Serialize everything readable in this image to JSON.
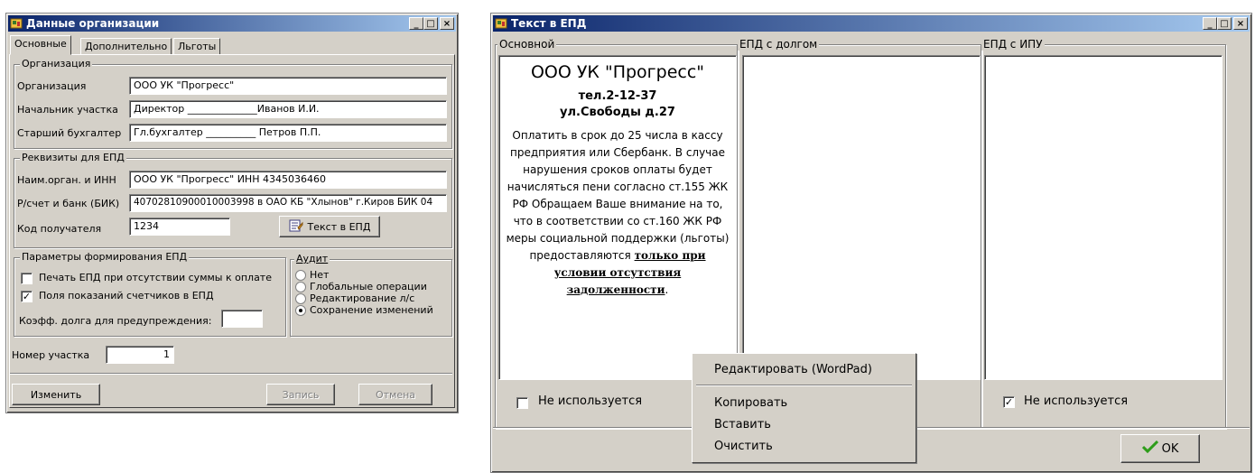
{
  "left_window": {
    "title": "Данные организации",
    "tabs": [
      "Основные",
      "Дополнительно",
      "Льготы"
    ],
    "org_group": {
      "title": "Организация",
      "rows": [
        {
          "label": "Организация",
          "value": "ООО УК \"Прогресс\""
        },
        {
          "label": "Начальник участка",
          "value": "Директор ______________Иванов И.И."
        },
        {
          "label": "Старший бухгалтер",
          "value": "Гл.бухгалтер __________ Петров П.П."
        }
      ]
    },
    "req_group": {
      "title": "Реквизиты для ЕПД",
      "rows": [
        {
          "label": "Наим.орган. и ИНН",
          "value": "ООО УК \"Прогресс\"  ИНН 4345036460"
        },
        {
          "label": "Р/счет и банк (БИК)",
          "value": "40702810900010003998 в ОАО КБ \"Хлынов\" г.Киров БИК 04"
        },
        {
          "label": "Код получателя",
          "value": "1234"
        }
      ],
      "epd_button": "Текст в ЕПД"
    },
    "params_group": {
      "title": "Параметры формирования ЕПД",
      "print_no_sum": {
        "label": "Печать ЕПД при отсутствии суммы к оплате",
        "checked": false
      },
      "meter_fields": {
        "label": "Поля показаний счетчиков в ЕПД",
        "checked": true
      },
      "coef_label": "Коэфф. долга для предупреждения:",
      "coef_value": ""
    },
    "audit_group": {
      "title": "Аудит",
      "options": [
        {
          "label": "Нет",
          "selected": false
        },
        {
          "label": "Глобальные операции",
          "selected": false
        },
        {
          "label": "Редактирование л/с",
          "selected": false
        },
        {
          "label": "Сохранение изменений",
          "selected": true
        }
      ]
    },
    "area_number": {
      "label": "Номер участка",
      "value": "1"
    },
    "buttons": {
      "change": "Изменить",
      "save": "Запись",
      "cancel": "Отмена"
    }
  },
  "right_window": {
    "title": "Текст в ЕПД",
    "columns": [
      {
        "title": "Основной",
        "unused_label": "Не используется",
        "unused_checked": false
      },
      {
        "title": "ЕПД с долгом"
      },
      {
        "title": "ЕПД с ИПУ",
        "unused_label": "Не используется",
        "unused_checked": true
      }
    ],
    "main_text": {
      "org": "ООО УК \"Прогресс\"",
      "phone": "тел.2-12-37",
      "address": "ул.Свободы д.27",
      "body": "Оплатить в срок до 25 числа в кассу предприятия или Сбербанк. В случае нарушения сроков оплаты будет начисляться пени согласно ст.155 ЖК РФ Обращаем Ваше внимание на то, что в соответствии со ст.160 ЖК РФ меры социальной поддержки (льготы) предоставляются",
      "emphasis": "только при условии отсутствия задолженности",
      "end": "."
    },
    "context_menu": [
      "Редактировать (WordPad)",
      "Копировать",
      "Вставить",
      "Очистить"
    ],
    "ok_button": "OK"
  },
  "window_controls": {
    "minimize": "_",
    "maximize": "□",
    "close": "×"
  },
  "colors": {
    "titlebar_start": "#0a246a",
    "titlebar_end": "#a6caf0",
    "face": "#d4d0c8",
    "ok_check": "#2e9d1a"
  }
}
